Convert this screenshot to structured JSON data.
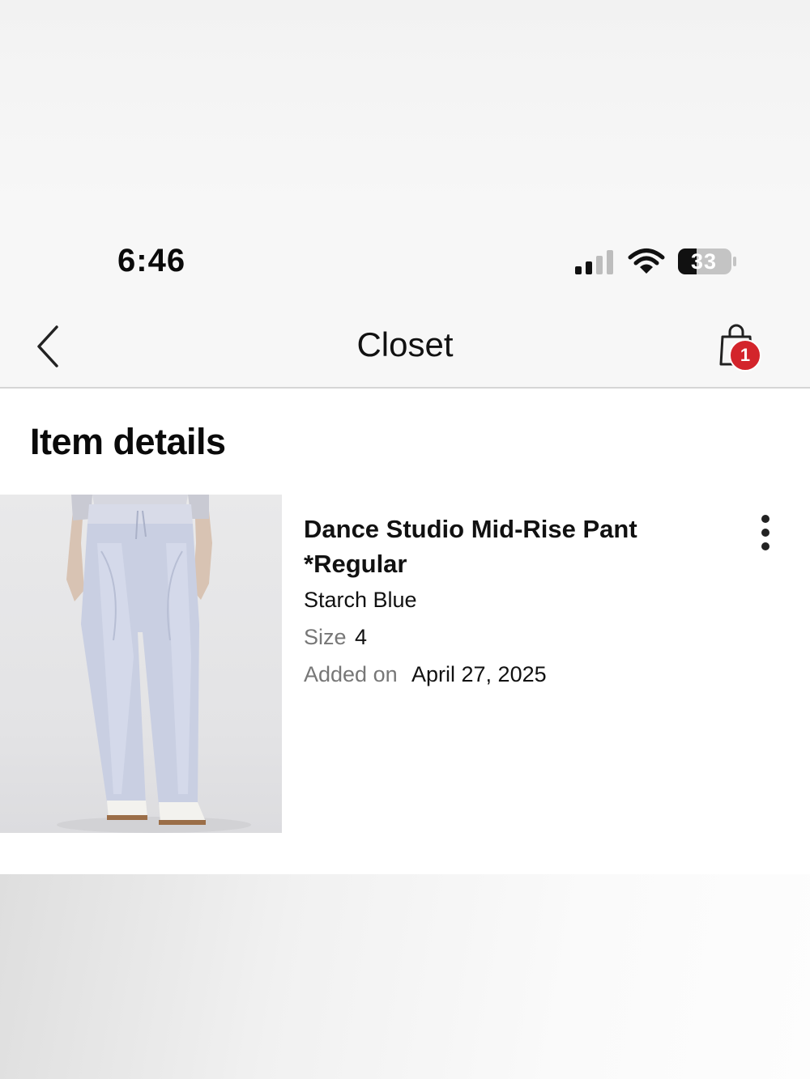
{
  "status_bar": {
    "time": "6:46",
    "battery_level": "33",
    "signal_icon": "cellular-signal-icon",
    "wifi_icon": "wifi-icon",
    "battery_icon": "battery-icon"
  },
  "nav": {
    "back_icon": "chevron-left-icon",
    "title": "Closet",
    "bag_icon": "shopping-bag-icon",
    "bag_count": "1"
  },
  "page": {
    "section_title": "Item details"
  },
  "item": {
    "name": "Dance Studio Mid-Rise Pant *Regular",
    "color": "Starch Blue",
    "size_label": "Size",
    "size_value": "4",
    "added_label": "Added on",
    "added_value": "April 27, 2025",
    "image_alt": "pants-photo",
    "more_icon": "more-vertical-icon"
  },
  "colors": {
    "badge": "#d3242b",
    "nav_bg": "#f7f7f7",
    "secondary_text": "#777777"
  }
}
